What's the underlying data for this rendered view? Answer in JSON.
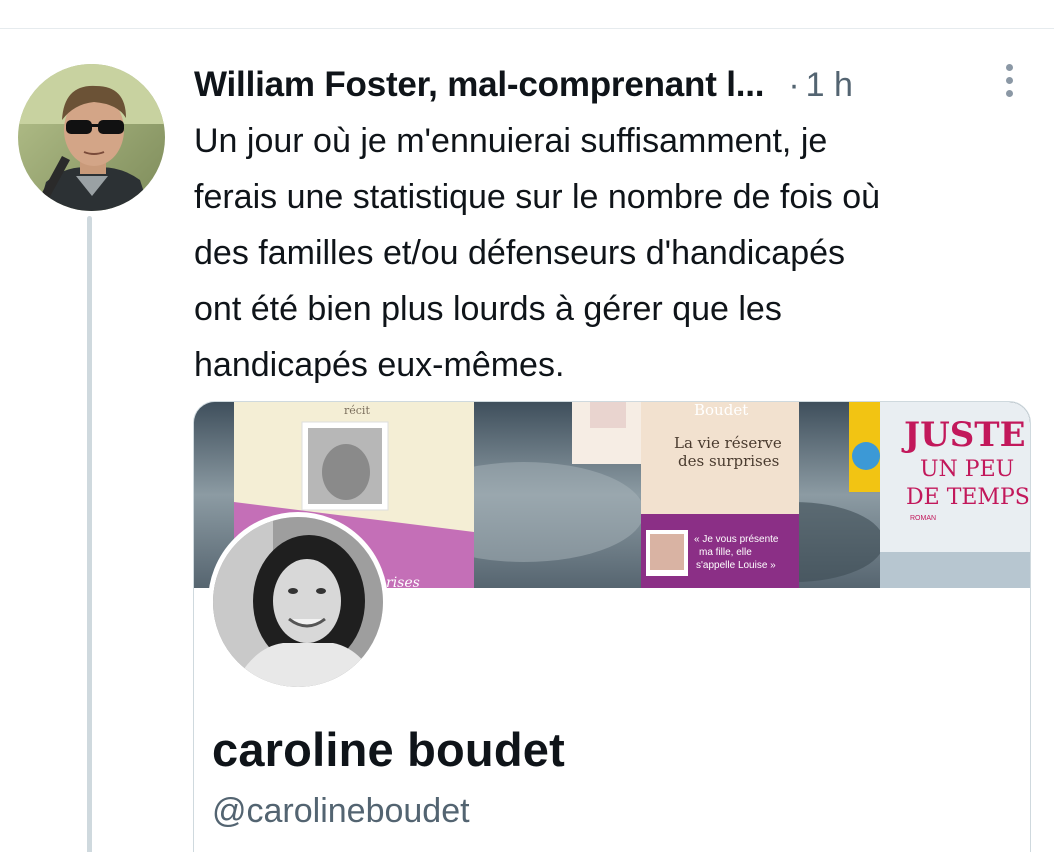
{
  "tweet": {
    "author_name": "William Foster, mal-comprenant l...",
    "separator": "·",
    "time": "1 h",
    "more_icon": "more-vertical-icon",
    "text": "Un jour où je m'ennuierai suffisamment, je\nferais une statistique sur le nombre de fois où\ndes familles et/ou défenseurs d'handicapés\nont été bien plus lourds à gérer que les\nhandicapés eux-mêmes."
  },
  "card": {
    "profile_name": "caroline boudet",
    "profile_handle": "@carolineboudet",
    "banner": {
      "book1_top": "récit",
      "book1_bottom": "rises",
      "book2_author": "Boudet",
      "book2_title_line1": "La vie réserve",
      "book2_title_line2": "des surprises",
      "book2_quote_line1": "« Je vous présente",
      "book2_quote_line2": "ma fille, elle",
      "book2_quote_line3": "s'appelle Louise »",
      "book3_title_line1": "JUSTE",
      "book3_title_line2": "UN PEU",
      "book3_title_line3": "DE TEMPS",
      "book3_genre": "ROMAN"
    }
  },
  "colors": {
    "text_primary": "#0f1419",
    "text_secondary": "#536471",
    "border": "#cfd9de",
    "book_pink": "#c2185b",
    "book_purple": "#9c3aa6"
  }
}
